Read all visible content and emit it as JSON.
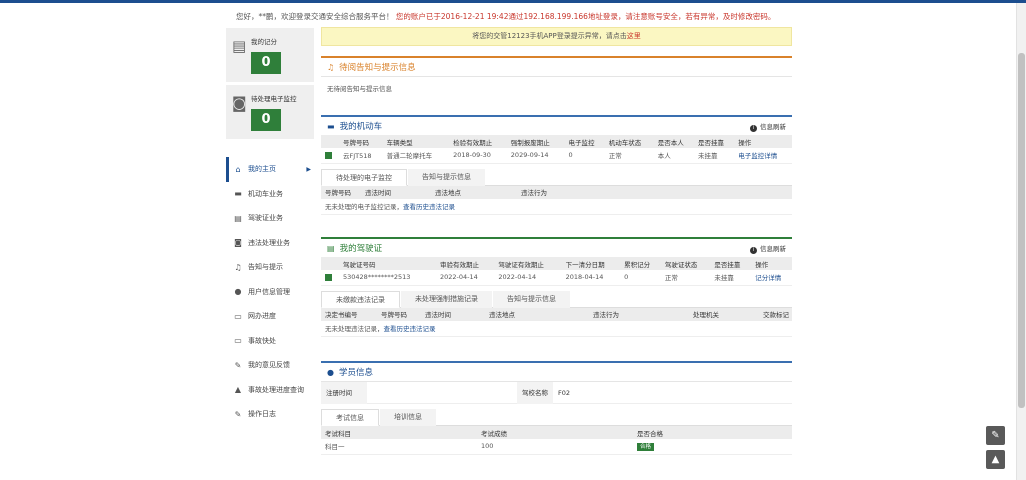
{
  "welcome": {
    "greeting": "您好，**鹏，欢迎登录交通安全综合服务平台！",
    "last_login": "您的账户已于2016-12-21 19:42通过192.168.199.166地址登录，请注意账号安全，若有异常，",
    "change_pwd": "及时修改密码。"
  },
  "stats": {
    "points_label": "我的记分",
    "points_value": "0",
    "monitor_label": "待处理电子监控",
    "monitor_value": "0"
  },
  "nav": [
    {
      "label": "我的主页",
      "icon": "home-icon",
      "glyph": "⌂"
    },
    {
      "label": "机动车业务",
      "icon": "truck-icon",
      "glyph": "▬"
    },
    {
      "label": "驾驶证业务",
      "icon": "card-icon",
      "glyph": "▤"
    },
    {
      "label": "违法处理业务",
      "icon": "camera-icon",
      "glyph": "◙"
    },
    {
      "label": "告知与提示",
      "icon": "bell-icon",
      "glyph": "♫"
    },
    {
      "label": "用户信息管理",
      "icon": "user-icon",
      "glyph": "●"
    },
    {
      "label": "网办进度",
      "icon": "progress-icon",
      "glyph": "▭"
    },
    {
      "label": "事故快处",
      "icon": "accident-icon",
      "glyph": "▭"
    },
    {
      "label": "我的意见反馈",
      "icon": "edit-icon",
      "glyph": "✎"
    },
    {
      "label": "事故处理进度查询",
      "icon": "road-icon",
      "glyph": "▲"
    },
    {
      "label": "操作日志",
      "icon": "log-icon",
      "glyph": "✎"
    }
  ],
  "notice": {
    "text": "将您的交管12123手机APP登录提示异常，请点击",
    "link": "这里"
  },
  "notify": {
    "title": "待阅告知与提示信息",
    "empty": "无待阅告知与提示信息"
  },
  "vehicle": {
    "title": "我的机动车",
    "refresh": "信息刷新",
    "headers": [
      "号牌号码",
      "车辆类型",
      "检验有效期止",
      "强制报废期止",
      "电子监控",
      "机动车状态",
      "是否本人",
      "是否挂靠",
      "操作"
    ],
    "row": [
      "云FJT518",
      "普通二轮摩托车",
      "2018-09-30",
      "2029-09-14",
      "0",
      "正常",
      "本人",
      "未挂靠",
      "电子监控详情"
    ],
    "tabs": [
      "待处理的电子监控",
      "告知与提示信息"
    ],
    "sub_headers": [
      "号牌号码",
      "违法时间",
      "违法地点",
      "违法行为"
    ],
    "sub_empty": "无未处理的电子监控记录，",
    "sub_link": "查看历史违法记录"
  },
  "license": {
    "title": "我的驾驶证",
    "refresh": "信息刷新",
    "headers": [
      "驾驶证号码",
      "审验有效期止",
      "驾驶证有效期止",
      "下一清分日期",
      "累积记分",
      "驾驶证状态",
      "是否挂靠",
      "操作"
    ],
    "row": [
      "530428********2513",
      "2022-04-14",
      "2022-04-14",
      "2018-04-14",
      "0",
      "正常",
      "未挂靠",
      "记分详情"
    ],
    "tabs": [
      "未缴款违法记录",
      "未处理强制措施记录",
      "告知与提示信息"
    ],
    "sub_headers": [
      "决定书编号",
      "号牌号码",
      "违法时间",
      "违法地点",
      "违法行为",
      "处理机关",
      "交款标记"
    ],
    "sub_empty": "无未处理违法记录，",
    "sub_link": "查看历史违法记录"
  },
  "student": {
    "title": "学员信息",
    "reg_label": "注册时间",
    "reg_value": "",
    "school_label": "驾校名称",
    "school_value": "F02",
    "tabs": [
      "考试信息",
      "培训信息"
    ],
    "headers": [
      "考试科目",
      "考试成绩",
      "是否合格"
    ],
    "row": [
      "科目一",
      "100",
      "合格"
    ]
  },
  "colors": {
    "brand": "#1c4e8f",
    "green": "#2f7f3a",
    "alert": "#c8352b",
    "orange": "#d9822b"
  }
}
